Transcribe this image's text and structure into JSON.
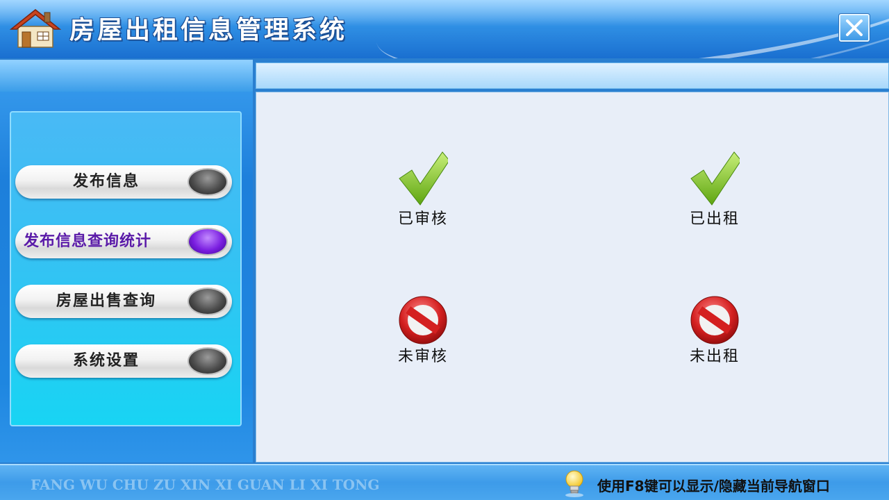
{
  "app": {
    "title": "房屋出租信息管理系统",
    "close_label": "×"
  },
  "sidebar": {
    "items": [
      {
        "label": "发布信息",
        "active": false
      },
      {
        "label": "发布信息查询统计",
        "active": true
      },
      {
        "label": "房屋出售查询",
        "active": false
      },
      {
        "label": "系统设置",
        "active": false
      }
    ]
  },
  "content": {
    "items": [
      {
        "label": "已审核",
        "icon": "check-icon"
      },
      {
        "label": "已出租",
        "icon": "check-icon"
      },
      {
        "label": "未审核",
        "icon": "no-entry-icon"
      },
      {
        "label": "未出租",
        "icon": "no-entry-icon"
      }
    ]
  },
  "footer": {
    "pinyin": "FANG WU CHU ZU XIN XI GUAN LI XI TONG",
    "hint": "使用F8键可以显示/隐藏当前导航窗口"
  },
  "colors": {
    "active_led": "#7a1ee0",
    "active_text": "#5a1aa8",
    "check_green": "#7cc11f",
    "no_entry_red": "#d42020"
  }
}
